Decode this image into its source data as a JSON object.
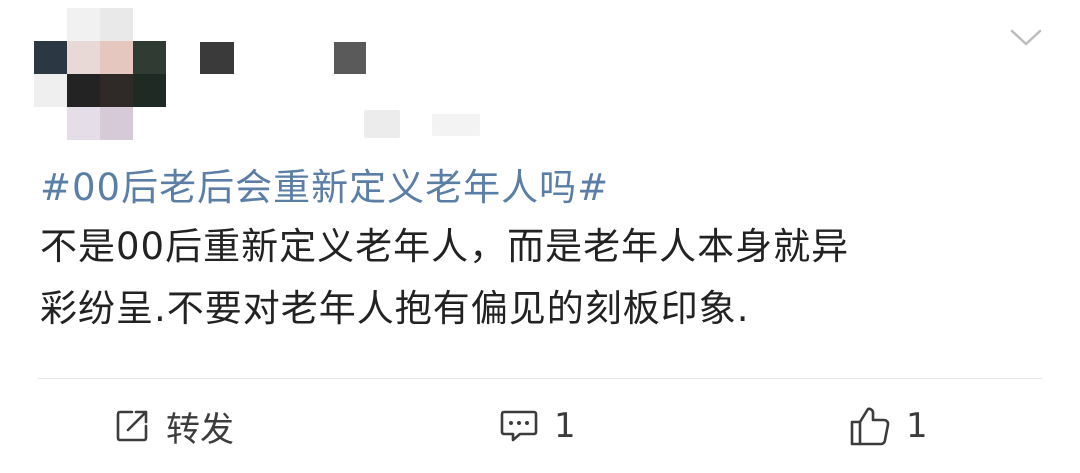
{
  "post": {
    "topic": "#00后老后会重新定义老年人吗#",
    "body_line1": "不是00后重新定义老年人，而是老年人本身就异",
    "body_line2": "彩纷呈.不要对老年人抱有偏见的刻板印象."
  },
  "actions": {
    "repost_label": "转发",
    "comment_count": "1",
    "like_count": "1"
  },
  "icons": {
    "more": "chevron-down-icon",
    "repost": "share-icon",
    "comment": "comment-icon",
    "like": "thumbs-up-icon"
  },
  "colors": {
    "topic_link": "#5b7ea6",
    "text": "#222222",
    "icon": "#3c3c3c"
  }
}
